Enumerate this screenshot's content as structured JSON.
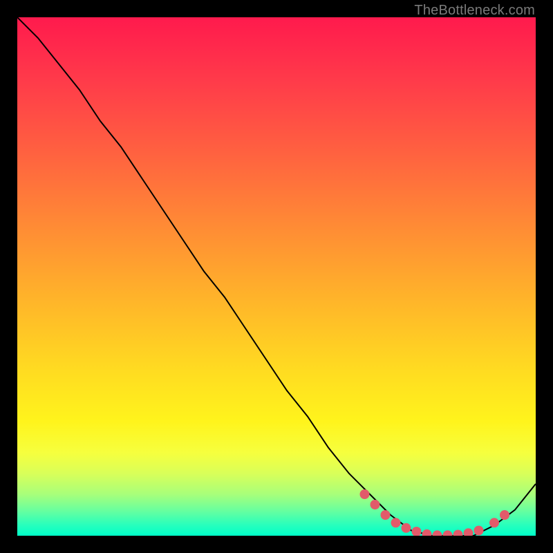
{
  "watermark": "TheBottleneck.com",
  "chart_data": {
    "type": "line",
    "title": "",
    "xlabel": "",
    "ylabel": "",
    "xlim": [
      0,
      100
    ],
    "ylim": [
      0,
      100
    ],
    "grid": false,
    "legend": false,
    "series": [
      {
        "name": "curve",
        "x": [
          0,
          4,
          8,
          12,
          16,
          20,
          24,
          28,
          32,
          36,
          40,
          44,
          48,
          52,
          56,
          60,
          64,
          68,
          72,
          76,
          80,
          84,
          88,
          92,
          96,
          100
        ],
        "y": [
          100,
          96,
          91,
          86,
          80,
          75,
          69,
          63,
          57,
          51,
          46,
          40,
          34,
          28,
          23,
          17,
          12,
          8,
          4,
          1,
          0,
          0,
          0,
          2,
          5,
          10
        ]
      }
    ],
    "markers": [
      {
        "x": 67,
        "y": 8
      },
      {
        "x": 69,
        "y": 6
      },
      {
        "x": 71,
        "y": 4
      },
      {
        "x": 73,
        "y": 2.5
      },
      {
        "x": 75,
        "y": 1.5
      },
      {
        "x": 77,
        "y": 0.8
      },
      {
        "x": 79,
        "y": 0.3
      },
      {
        "x": 81,
        "y": 0.1
      },
      {
        "x": 83,
        "y": 0.1
      },
      {
        "x": 85,
        "y": 0.2
      },
      {
        "x": 87,
        "y": 0.5
      },
      {
        "x": 89,
        "y": 1.0
      },
      {
        "x": 92,
        "y": 2.5
      },
      {
        "x": 94,
        "y": 4.0
      }
    ],
    "gradient_colors": {
      "top": "#ff1a4d",
      "mid": "#ffdb21",
      "bottom": "#00ffc8"
    }
  }
}
